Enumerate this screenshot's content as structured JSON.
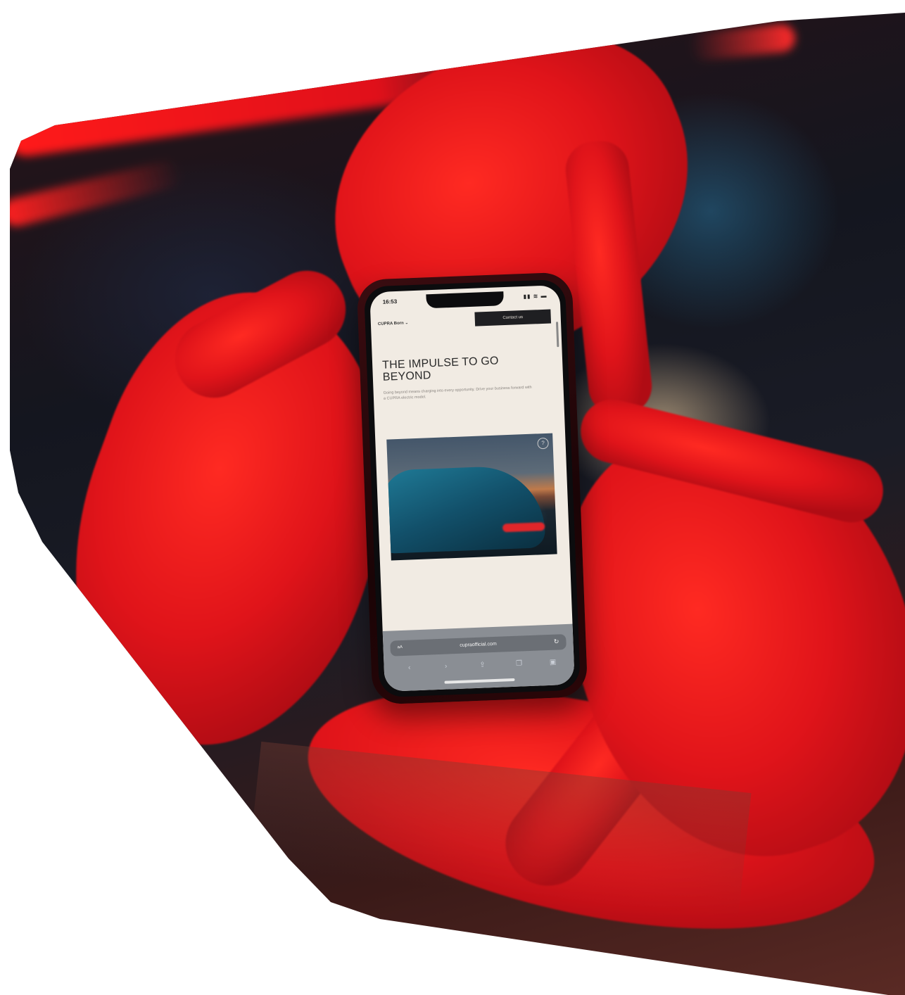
{
  "phone": {
    "status_time": "16:53",
    "status_icons": "▮▮ ≋ ▬",
    "site": {
      "brand": "CUPRA Born ⌄",
      "cta_label": "Contact us",
      "headline": "THE IMPULSE TO GO BEYOND",
      "body": "Going beyond means charging into every opportunity. Drive your business forward with a CUPRA electric model.",
      "image_badge": "?"
    },
    "browser": {
      "text_size_label": "aA",
      "url": "cupraofficial.com",
      "reload_icon": "↻"
    }
  }
}
